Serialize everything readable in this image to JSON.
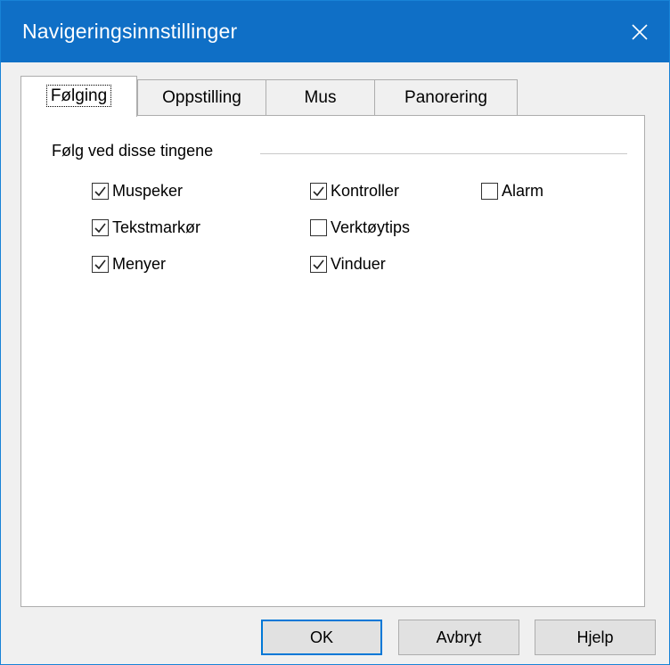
{
  "window": {
    "title": "Navigeringsinnstillinger"
  },
  "tabs": [
    {
      "label": "Følging",
      "active": true
    },
    {
      "label": "Oppstilling",
      "active": false
    },
    {
      "label": "Mus",
      "active": false
    },
    {
      "label": "Panorering",
      "active": false
    }
  ],
  "group": {
    "label": "Følg ved disse tingene"
  },
  "checkboxes": [
    {
      "label": "Muspeker",
      "checked": true
    },
    {
      "label": "Tekstmarkør",
      "checked": true
    },
    {
      "label": "Menyer",
      "checked": true
    },
    {
      "label": "Kontroller",
      "checked": true
    },
    {
      "label": "Verktøytips",
      "checked": false
    },
    {
      "label": "Vinduer",
      "checked": true
    },
    {
      "label": "Alarm",
      "checked": false
    }
  ],
  "buttons": {
    "ok": "OK",
    "cancel": "Avbryt",
    "help": "Hjelp"
  },
  "colors": {
    "titlebar": "#0f6fc6",
    "accent": "#0078d7"
  }
}
